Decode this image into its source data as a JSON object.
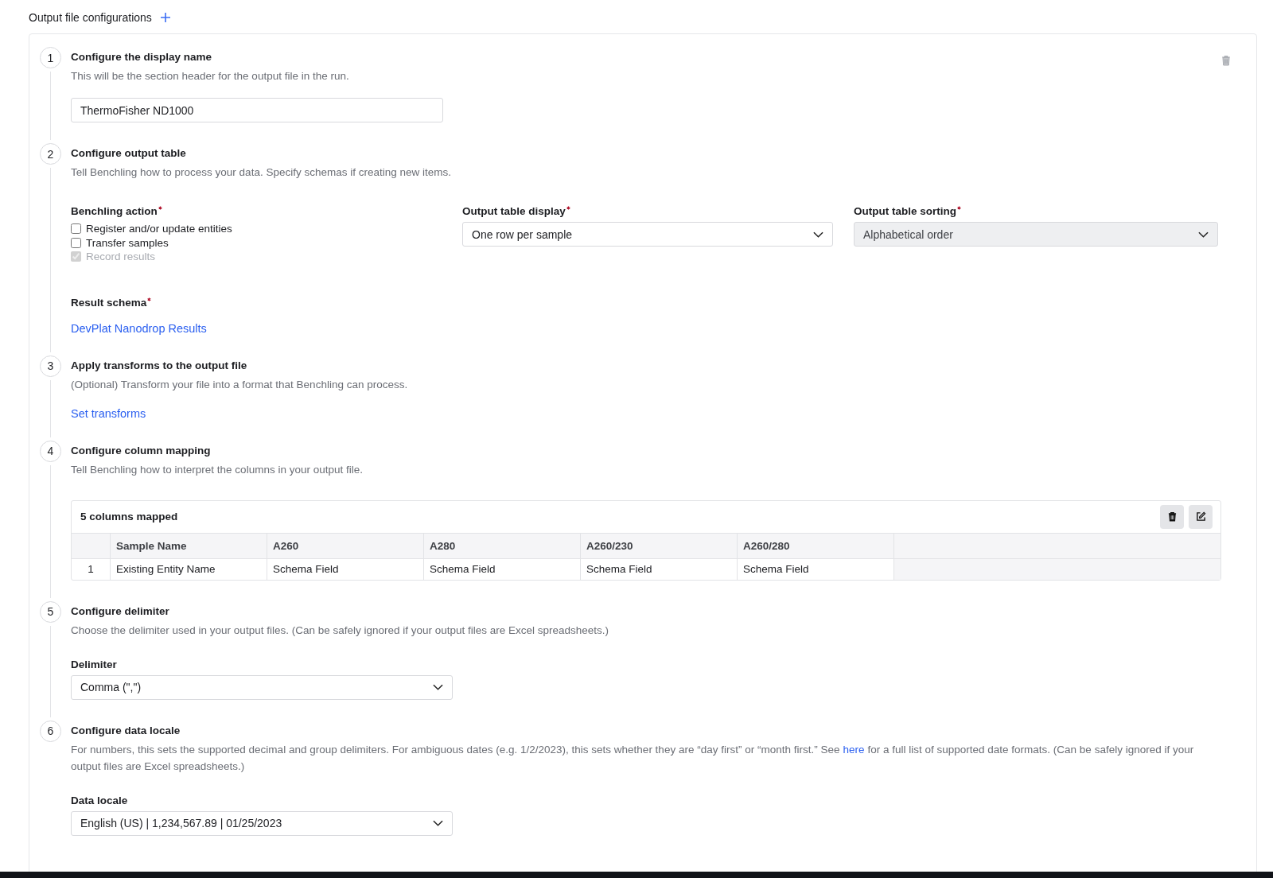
{
  "header": {
    "title": "Output file configurations"
  },
  "steps": [
    {
      "number": "1",
      "kind": "text_field",
      "title": "Configure the display name",
      "description": "This will be the section header for the output file in the run.",
      "field": {
        "value": "ThermoFisher ND1000"
      }
    },
    {
      "number": "2",
      "kind": "output_table",
      "title": "Configure output table",
      "description": "Tell Benchling how to process your data. Specify schemas if creating new items.",
      "action": {
        "label": "Benchling action",
        "required": true,
        "options": [
          {
            "label": "Register and/or update entities",
            "checked": false,
            "disabled": false
          },
          {
            "label": "Transfer samples",
            "checked": false,
            "disabled": false
          },
          {
            "label": "Record results",
            "checked": true,
            "disabled": true
          }
        ]
      },
      "selects": [
        {
          "label": "Output table display",
          "required": true,
          "value": "One row per sample",
          "disabled": false
        },
        {
          "label": "Output table sorting",
          "required": true,
          "value": "Alphabetical order",
          "disabled": true
        }
      ],
      "schema": {
        "label": "Result schema",
        "required": true,
        "link": "DevPlat Nanodrop Results"
      }
    },
    {
      "number": "3",
      "kind": "link",
      "title": "Apply transforms to the output file",
      "description": "(Optional) Transform your file into a format that Benchling can process.",
      "link": "Set transforms"
    },
    {
      "number": "4",
      "kind": "mapping",
      "title": "Configure column mapping",
      "description": "Tell Benchling how to interpret the columns in your output file.",
      "table": {
        "title": "5 columns mapped",
        "columns": [
          "Sample Name",
          "A260",
          "A280",
          "A260/230",
          "A260/280"
        ],
        "rows": [
          {
            "index": "1",
            "cells": [
              "Existing Entity Name",
              "Schema Field",
              "Schema Field",
              "Schema Field",
              "Schema Field"
            ]
          }
        ]
      }
    },
    {
      "number": "5",
      "kind": "select",
      "title": "Configure delimiter",
      "description": "Choose the delimiter used in your output files. (Can be safely ignored if your output files are Excel spreadsheets.)",
      "field": {
        "label": "Delimiter",
        "value": "Comma (\",\")"
      }
    },
    {
      "number": "6",
      "kind": "select",
      "title": "Configure data locale",
      "description": "For numbers, this sets the supported decimal and group delimiters. For ambiguous dates (e.g. 1/2/2023), this sets whether they are “day first” or “month first.” See",
      "description_link": "here",
      "description_after": "for a full list of supported date formats. (Can be safely ignored if your output files are Excel spreadsheets.)",
      "field": {
        "label": "Data locale",
        "value": "English (US) | 1,234,567.89 | 01/25/2023"
      }
    }
  ]
}
